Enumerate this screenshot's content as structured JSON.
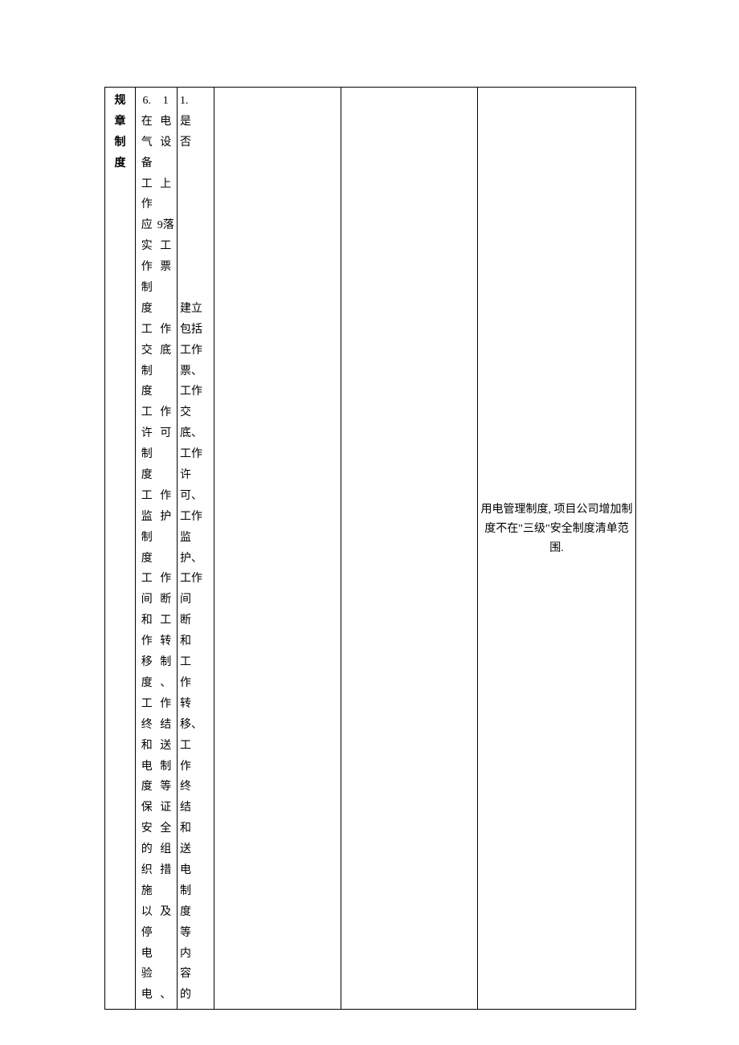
{
  "col1": [
    "规",
    "章",
    "制",
    "度"
  ],
  "col2_left": [
    "6.",
    "在",
    "气",
    "备",
    "工",
    "作",
    "应",
    "实",
    "作",
    "制",
    "度",
    "工",
    "交",
    "制",
    "度",
    "工",
    "许",
    "制",
    "度",
    "工",
    "监",
    "制",
    "度",
    "工",
    "间",
    "和",
    "作",
    "移",
    "度",
    "工",
    "终",
    "和",
    "电",
    "度",
    "保",
    "安",
    "的",
    "织",
    "施",
    "以",
    "停",
    "电",
    "验",
    "电"
  ],
  "col2_right": [
    "1",
    "电",
    "设",
    "",
    "上",
    "",
    "9落",
    "工",
    "票",
    "",
    "",
    "作",
    "底",
    "",
    "",
    "作",
    "可",
    "",
    "",
    "作",
    "护",
    "",
    "",
    "作",
    "断",
    "工",
    "转",
    "制",
    "、",
    "作",
    "结",
    "送",
    "制",
    "等",
    "证",
    "全",
    "组",
    "措",
    "",
    "及",
    "",
    "",
    "",
    "、"
  ],
  "col3": [
    "1.",
    "是",
    "否",
    "",
    "",
    "",
    "",
    "",
    "",
    "",
    "建立",
    "包括",
    "工作",
    "票、",
    "工作",
    "交",
    "底、",
    "工作",
    "许",
    "可、",
    "工作",
    "监",
    "护、",
    "工作",
    "间",
    "断",
    "和",
    "工",
    "作",
    "转",
    "移、",
    "工",
    "作",
    "终",
    "结",
    "和",
    "送",
    "电",
    "制",
    "度",
    "等",
    "内",
    "容",
    "的"
  ],
  "col6": [
    "用电管理制度, 项目公",
    "司增加制度不在\"三级\"",
    "安全制度清单范围."
  ]
}
